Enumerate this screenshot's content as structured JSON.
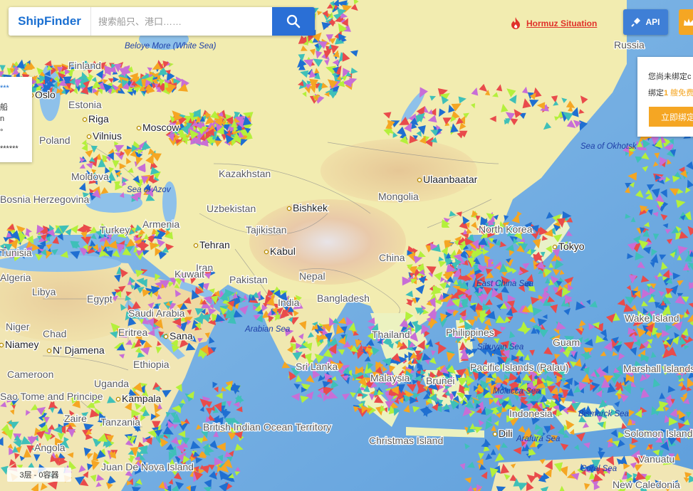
{
  "header": {
    "logo": "ShipFinder",
    "search_placeholder": "搜索船只、港口……"
  },
  "alert": {
    "label": "Hormuz Situation"
  },
  "api_button": {
    "label": "API"
  },
  "bind_panel": {
    "line1": "您尚未绑定c",
    "line2_prefix": "绑定",
    "line2_num": "1",
    "line2_suffix": " 艘免费",
    "button": "立即绑定"
  },
  "left_panel": {
    "line1": "***",
    "line2": "船",
    "line3": "n",
    "line4": "°",
    "line5": "******"
  },
  "status": {
    "layer_text": "3层 - 0容器"
  },
  "colors": {
    "brand_blue": "#1a6fd1",
    "search_button": "#2a6fd6",
    "alert_red": "#e0312a",
    "accent_orange": "#f5a623"
  },
  "map_labels": {
    "country": [
      {
        "text": "Russia"
      },
      {
        "text": "Finland"
      },
      {
        "text": "Estonia"
      },
      {
        "text": "Kazakhstan"
      },
      {
        "text": "Mongolia"
      },
      {
        "text": "Uzbekistan"
      },
      {
        "text": "Tajikistan"
      },
      {
        "text": "China"
      },
      {
        "text": "Iran"
      },
      {
        "text": "Pakistan"
      },
      {
        "text": "Nepal"
      },
      {
        "text": "India"
      },
      {
        "text": "Bangladesh"
      },
      {
        "text": "Thailand"
      },
      {
        "text": "Philippines"
      },
      {
        "text": "Turkey"
      },
      {
        "text": "Armenia"
      },
      {
        "text": "Kuwait"
      },
      {
        "text": "Saudi Arabia"
      },
      {
        "text": "Eritrea"
      },
      {
        "text": "Egypt"
      },
      {
        "text": "Libya"
      },
      {
        "text": "Tunisia"
      },
      {
        "text": "Algeria"
      },
      {
        "text": "Niger"
      },
      {
        "text": "Chad"
      },
      {
        "text": "Ethiopia"
      },
      {
        "text": "Cameroon"
      },
      {
        "text": "Uganda"
      },
      {
        "text": "Tanzania"
      },
      {
        "text": "Zaire"
      },
      {
        "text": "Angola"
      },
      {
        "text": "Moldova"
      },
      {
        "text": "Bosnia Herzegovina"
      },
      {
        "text": "Poland"
      },
      {
        "text": "Malaysia"
      },
      {
        "text": "Brunei"
      },
      {
        "text": "Indonesia"
      },
      {
        "text": "Wake Island"
      },
      {
        "text": "Marshall Islands"
      },
      {
        "text": "Pacific Islands (Palau)"
      },
      {
        "text": "British Indian Ocean Territory"
      },
      {
        "text": "Christmas Island"
      },
      {
        "text": "Juan De Nova Island"
      },
      {
        "text": "Guam"
      },
      {
        "text": "Sao Tome and Principe"
      },
      {
        "text": "Solomon Islands"
      },
      {
        "text": "Vanuatu"
      },
      {
        "text": "New Caledonia"
      },
      {
        "text": "Sri Lanka"
      },
      {
        "text": "North Korea"
      }
    ],
    "city": [
      {
        "text": "Oslo"
      },
      {
        "text": "Riga"
      },
      {
        "text": "Vilnius"
      },
      {
        "text": "Moscow"
      },
      {
        "text": "Ulaanbaatar"
      },
      {
        "text": "Bishkek"
      },
      {
        "text": "Tehran"
      },
      {
        "text": "Kabul"
      },
      {
        "text": "Sana"
      },
      {
        "text": "N' Djamena"
      },
      {
        "text": "Niamey"
      },
      {
        "text": "Kampala"
      },
      {
        "text": "Dili"
      },
      {
        "text": "Tokyo"
      }
    ],
    "sea": [
      {
        "text": "Beloye More (White Sea)"
      },
      {
        "text": "Sea of Azov"
      },
      {
        "text": "Sea of Okhotsk"
      },
      {
        "text": "East China Sea"
      },
      {
        "text": "Arabian Sea"
      },
      {
        "text": "Sibuyan Sea"
      },
      {
        "text": "Molucca Sea"
      },
      {
        "text": "Arafura Sea"
      },
      {
        "text": "Bismarck Sea"
      },
      {
        "text": "Coral Sea"
      }
    ]
  }
}
